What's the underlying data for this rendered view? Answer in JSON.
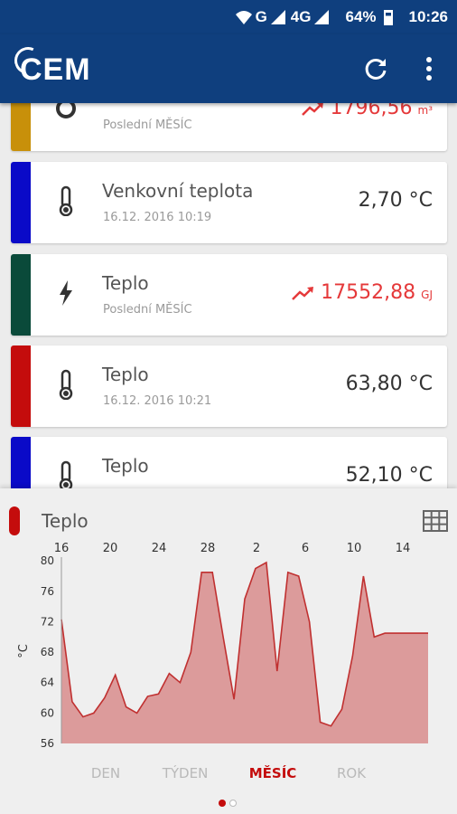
{
  "status_bar": {
    "network": "G",
    "network2": "4G",
    "battery": "64%",
    "time": "10:26"
  },
  "app_bar": {
    "logo_text": "CEM",
    "refresh_icon": "refresh-icon",
    "menu_icon": "more-vert-icon",
    "color": "#0f3f7e"
  },
  "cards": [
    {
      "name": "",
      "sub": "Poslední MĚSÍC",
      "value": "1796,56",
      "unit": "m³",
      "color": "#c8900a",
      "icon": "meter-icon",
      "trend": true
    },
    {
      "name": "Venkovní teplota",
      "sub": "16.12. 2016 10:19",
      "value": "2,70 °C",
      "unit": "",
      "color": "#0a0ac8",
      "icon": "thermometer-icon",
      "trend": false
    },
    {
      "name": "Teplo",
      "sub": "Poslední MĚSÍC",
      "value": "17552,88",
      "unit": "GJ",
      "color": "#0a4a3a",
      "icon": "lightning-icon",
      "trend": true
    },
    {
      "name": "Teplo",
      "sub": "16.12. 2016 10:21",
      "value": "63,80 °C",
      "unit": "",
      "color": "#c40c0c",
      "icon": "thermometer-icon",
      "trend": false
    },
    {
      "name": "Teplo",
      "sub": "",
      "value": "52,10 °C",
      "unit": "",
      "color": "#0a0ac8",
      "icon": "thermometer-icon",
      "trend": false
    }
  ],
  "panel": {
    "title": "Teplo",
    "grid_icon": "table-icon",
    "accent": "#c40c0c"
  },
  "chart_data": {
    "type": "area",
    "title": "",
    "xlabel": "",
    "ylabel": "°C",
    "x_ticks": [
      "16",
      "20",
      "24",
      "28",
      "2",
      "6",
      "10",
      "14"
    ],
    "y_ticks": [
      "80",
      "76",
      "72",
      "68",
      "64",
      "60",
      "56"
    ],
    "ylim": [
      56,
      80.5
    ],
    "grid": false,
    "fill_color": "#dc9b9b",
    "line_color": "#c03030",
    "x": [
      0,
      1,
      2,
      3,
      4,
      5,
      6,
      7,
      8,
      9,
      10,
      11,
      12,
      13,
      14,
      15,
      16,
      17,
      18,
      19,
      20,
      21,
      22,
      23,
      24,
      25,
      26,
      27,
      28,
      29,
      30,
      31,
      32,
      33,
      34
    ],
    "values": [
      72.3,
      61.5,
      59.5,
      60.0,
      62.0,
      65.0,
      60.8,
      60.0,
      62.2,
      62.5,
      65.2,
      64.0,
      68.0,
      78.5,
      78.5,
      70.0,
      61.8,
      75.0,
      79.0,
      79.8,
      65.5,
      78.5,
      78.0,
      72.0,
      58.8,
      58.3,
      60.5,
      67.5,
      78.0,
      70.0,
      70.5,
      70.5,
      70.5,
      70.5,
      70.5
    ]
  },
  "tabs": {
    "day": "DEN",
    "week": "TÝDEN",
    "month": "MĚSÍC",
    "year": "ROK",
    "active": "month"
  },
  "pager": {
    "pages": 2,
    "current": 1
  }
}
